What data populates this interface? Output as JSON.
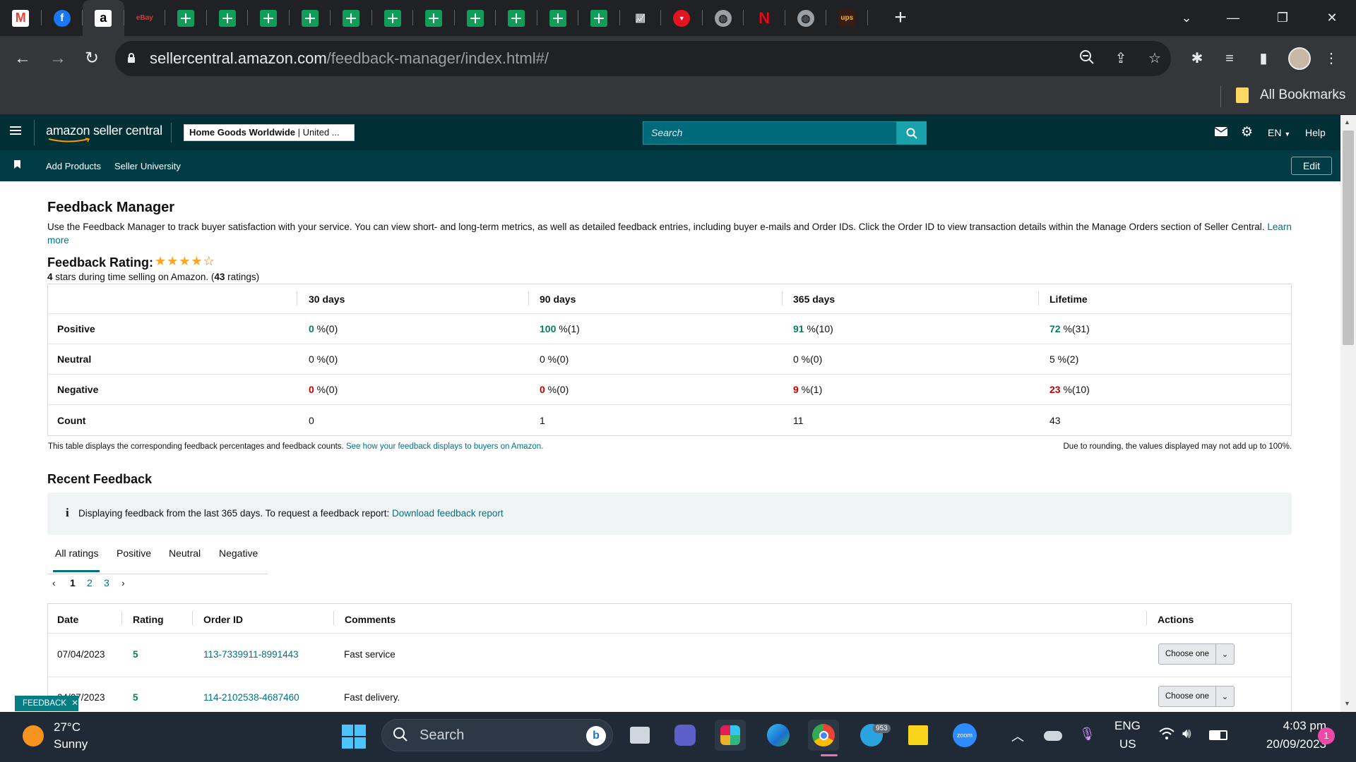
{
  "browser": {
    "tab_icons": [
      "gmail-icon",
      "facebook-icon",
      "amazon-icon",
      "ebay-icon",
      "sheets-icon",
      "sheets-icon",
      "sheets-icon",
      "sheets-icon",
      "sheets-icon",
      "sheets-icon",
      "sheets-icon",
      "sheets-icon",
      "sheets-icon",
      "sheets-icon",
      "sheets-icon",
      "chart-icon",
      "redbubble-icon",
      "globe-icon",
      "netflix-icon",
      "globe-icon",
      "ups-icon"
    ],
    "url_domain": "sellercentral.amazon.com",
    "url_path": "/feedback-manager/index.html#/",
    "all_bookmarks": "All Bookmarks"
  },
  "header": {
    "logo": "amazon seller central",
    "store_name": "Home Goods Worldwide",
    "store_region": " | United ...",
    "search_placeholder": "Search",
    "language": "EN",
    "help": "Help",
    "nav_add_products": "Add Products",
    "nav_seller_university": "Seller University",
    "edit": "Edit"
  },
  "page": {
    "title": "Feedback Manager",
    "description": "Use the Feedback Manager to track buyer satisfaction with your service. You can view short- and long-term metrics, as well as detailed feedback entries, including buyer e-mails and Order IDs. Click the Order ID to view transaction details within the Manage Orders section of Seller Central.",
    "learn_more": "Learn more",
    "rating_label": "Feedback Rating:",
    "rating_stars": 4,
    "rating_max": 5,
    "rating_stars_num": "4",
    "rating_text_mid": " stars during time selling on Amazon. (",
    "rating_count": "43",
    "rating_text_end": " ratings)"
  },
  "metrics": {
    "columns": [
      "30 days",
      "90 days",
      "365 days",
      "Lifetime"
    ],
    "rows": [
      {
        "label": "Positive",
        "cells": [
          {
            "v": "0",
            "u": " %(0)",
            "c": "g"
          },
          {
            "v": "100",
            "u": " %(1)",
            "c": "g"
          },
          {
            "v": "91",
            "u": " %(10)",
            "c": "g"
          },
          {
            "v": "72",
            "u": " %(31)",
            "c": "g"
          }
        ]
      },
      {
        "label": "Neutral",
        "cells": [
          {
            "v": "0",
            "u": " %(0)",
            "c": ""
          },
          {
            "v": "0",
            "u": " %(0)",
            "c": ""
          },
          {
            "v": "0",
            "u": " %(0)",
            "c": ""
          },
          {
            "v": "5",
            "u": " %(2)",
            "c": ""
          }
        ]
      },
      {
        "label": "Negative",
        "cells": [
          {
            "v": "0",
            "u": " %(0)",
            "c": "r"
          },
          {
            "v": "0",
            "u": " %(0)",
            "c": "r"
          },
          {
            "v": "9",
            "u": " %(1)",
            "c": "r"
          },
          {
            "v": "23",
            "u": " %(10)",
            "c": "r"
          }
        ]
      },
      {
        "label": "Count",
        "cells": [
          {
            "v": "0",
            "u": "",
            "c": ""
          },
          {
            "v": "1",
            "u": "",
            "c": ""
          },
          {
            "v": "11",
            "u": "",
            "c": ""
          },
          {
            "v": "43",
            "u": "",
            "c": ""
          }
        ]
      }
    ],
    "footnote": "This table displays the corresponding feedback percentages and feedback counts.",
    "footnote_link": "See how your feedback displays to buyers on Amazon.",
    "rounding_note": "Due to rounding, the values displayed may not add up to 100%."
  },
  "recent": {
    "title": "Recent Feedback",
    "info_text": "Displaying feedback from the last 365 days. To request a feedback report:",
    "info_link": "Download feedback report",
    "tabs": [
      "All ratings",
      "Positive",
      "Neutral",
      "Negative"
    ],
    "pages": [
      "1",
      "2",
      "3"
    ],
    "headers": {
      "date": "Date",
      "rating": "Rating",
      "order": "Order ID",
      "comments": "Comments",
      "actions": "Actions"
    },
    "rows": [
      {
        "date": "07/04/2023",
        "rating": "5",
        "order": "113-7339911-8991443",
        "comment": "Fast service",
        "action": "Choose one"
      },
      {
        "date": "04/07/2023",
        "rating": "5",
        "order": "114-2102538-4687460",
        "comment": "Fast delivery.",
        "action": "Choose one"
      }
    ],
    "feedback_tab": "FEEDBACK"
  },
  "taskbar": {
    "temp": "27°C",
    "weather": "Sunny",
    "search": "Search",
    "lang1": "ENG",
    "lang2": "US",
    "time": "4:03 pm",
    "date": "20/09/2023",
    "notif_count": "1",
    "telegram_badge": "953"
  },
  "colors": {
    "header": "#002f36",
    "subnav": "#013c44",
    "positive": "#067d62",
    "negative": "#c40000",
    "link": "#007185"
  }
}
